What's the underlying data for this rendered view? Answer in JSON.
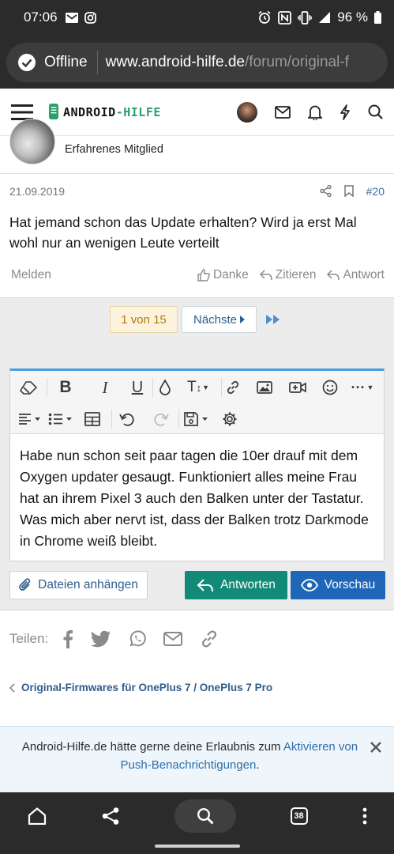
{
  "status_bar": {
    "time": "07:06",
    "battery": "96 %"
  },
  "browser": {
    "offline_label": "Offline",
    "url_domain": "www.android-hilfe.de",
    "url_path": "/forum/original-f"
  },
  "site": {
    "logo_android": "ANDROID",
    "logo_hilfe": "-HILFE"
  },
  "user": {
    "title": "Erfahrenes Mitglied"
  },
  "post": {
    "date": "21.09.2019",
    "number": "#20",
    "text": "Hat jemand schon das Update erhalten? Wird ja erst Mal wohl nur an wenigen Leute verteilt",
    "report": "Melden",
    "thanks": "Danke",
    "quote": "Zitieren",
    "reply": "Antwort"
  },
  "pagination": {
    "current": "1 von 15",
    "next": "Nächste"
  },
  "editor": {
    "text": "Habe nun schon seit paar tagen die 10er drauf mit dem Oxygen updater gesaugt. Funktioniert alles meine Frau hat an ihrem Pixel 3 auch den Balken unter der Tastatur. Was mich aber nervt ist, dass der Balken trotz Darkmode in Chrome weiß bleibt.",
    "attach_label": "Dateien anhängen",
    "reply_label": "Antworten",
    "preview_label": "Vorschau"
  },
  "share": {
    "label": "Teilen:"
  },
  "breadcrumb": {
    "label": "Original-Firmwares für OnePlus 7 / OnePlus 7 Pro"
  },
  "notice": {
    "text_before": "Android-Hilfe.de hätte gerne deine Erlaubnis zum ",
    "link": "Aktivieren von Push-Benachrichtigungen",
    "text_after": "."
  },
  "bottom_bar": {
    "tab_count": "38"
  },
  "colors": {
    "accent_green": "#118a78",
    "accent_blue": "#1d66b8",
    "link_blue": "#2f5d8c",
    "editor_top": "#4a9ce0"
  }
}
